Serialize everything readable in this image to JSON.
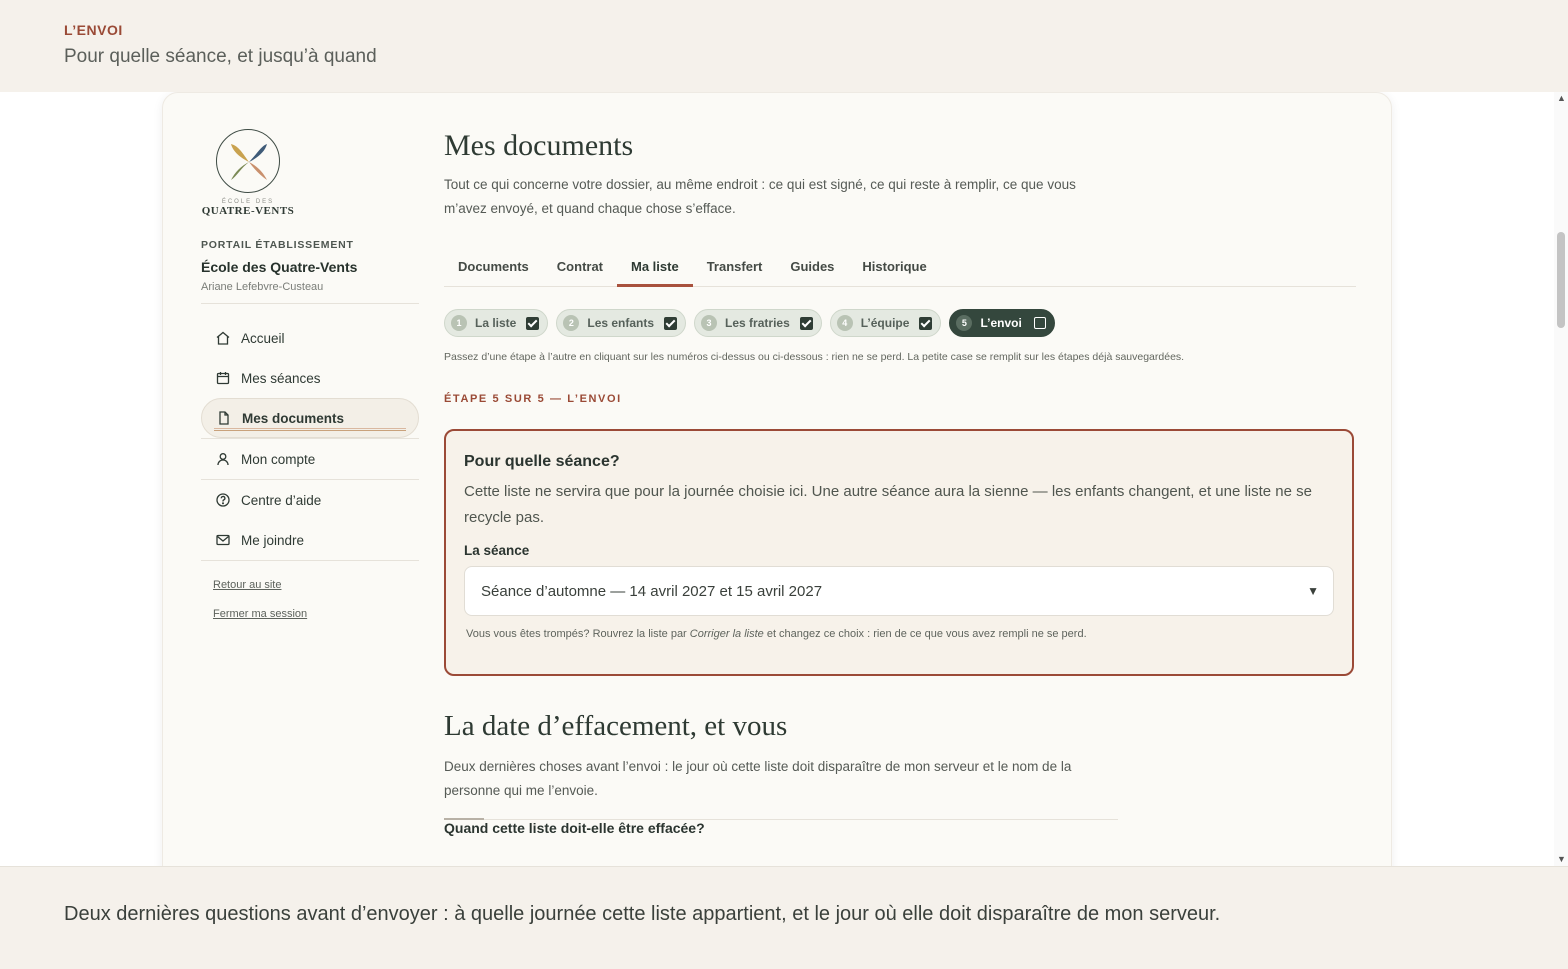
{
  "banner": {
    "kicker": "L’ENVOI",
    "subtitle": "Pour quelle séance, et jusqu’à quand"
  },
  "logo": {
    "small": "ÉCOLE DES",
    "name": "QUATRE-VENTS"
  },
  "sidebar": {
    "portal_kicker": "PORTAIL ÉTABLISSEMENT",
    "school": "École des Quatre-Vents",
    "user": "Ariane Lefebvre-Custeau",
    "items": [
      {
        "label": "Accueil",
        "icon": "home-icon"
      },
      {
        "label": "Mes séances",
        "icon": "calendar-icon"
      },
      {
        "label": "Mes documents",
        "icon": "document-icon",
        "active": true
      },
      {
        "label": "Mon compte",
        "icon": "user-icon"
      },
      {
        "label": "Centre d’aide",
        "icon": "help-icon"
      },
      {
        "label": "Me joindre",
        "icon": "mail-icon"
      }
    ],
    "links": [
      "Retour au site",
      "Fermer ma session"
    ]
  },
  "main": {
    "title": "Mes documents",
    "intro": "Tout ce qui concerne votre dossier, au même endroit : ce qui est signé, ce qui reste à remplir, ce que vous m’avez envoyé, et quand chaque chose s’efface.",
    "tabs": [
      {
        "label": "Documents"
      },
      {
        "label": "Contrat"
      },
      {
        "label": "Ma liste",
        "active": true
      },
      {
        "label": "Transfert"
      },
      {
        "label": "Guides"
      },
      {
        "label": "Historique"
      }
    ],
    "steps": [
      {
        "num": "1",
        "label": "La liste",
        "done": true
      },
      {
        "num": "2",
        "label": "Les enfants",
        "done": true
      },
      {
        "num": "3",
        "label": "Les fratries",
        "done": true
      },
      {
        "num": "4",
        "label": "L’équipe",
        "done": true
      },
      {
        "num": "5",
        "label": "L’envoi",
        "done": false,
        "current": true
      }
    ],
    "steps_hint": "Passez d’une étape à l’autre en cliquant sur les numéros ci-dessus ou ci-dessous : rien ne se perd. La petite case se remplit sur les étapes déjà sauvegardées.",
    "step_kicker": "ÉTAPE 5 SUR 5 — L’ENVOI",
    "seance": {
      "title": "Pour quelle séance?",
      "text": "Cette liste ne servira que pour la journée choisie ici. Une autre séance aura la sienne — les enfants changent, et une liste ne se recycle pas.",
      "label": "La séance",
      "selected": "Séance d’automne — 14 avril 2027 et 15 avril 2027",
      "hint_before": "Vous vous êtes trompés? Rouvrez la liste par",
      "hint_em": "Corriger la liste",
      "hint_after": "et changez ce choix : rien de ce que vous avez rempli ne se perd."
    },
    "section_title": "La date d’effacement, et vous",
    "section_intro": "Deux dernières choses avant l’envoi : le jour où cette liste doit disparaître de mon serveur et le nom de la personne qui me l’envoie.",
    "question": "Quand cette liste doit-elle être effacée?"
  },
  "bottom": {
    "text": "Deux dernières questions avant d’envoyer : à quelle journée cette liste appartient, et le jour où elle doit disparaître de mon serveur."
  }
}
